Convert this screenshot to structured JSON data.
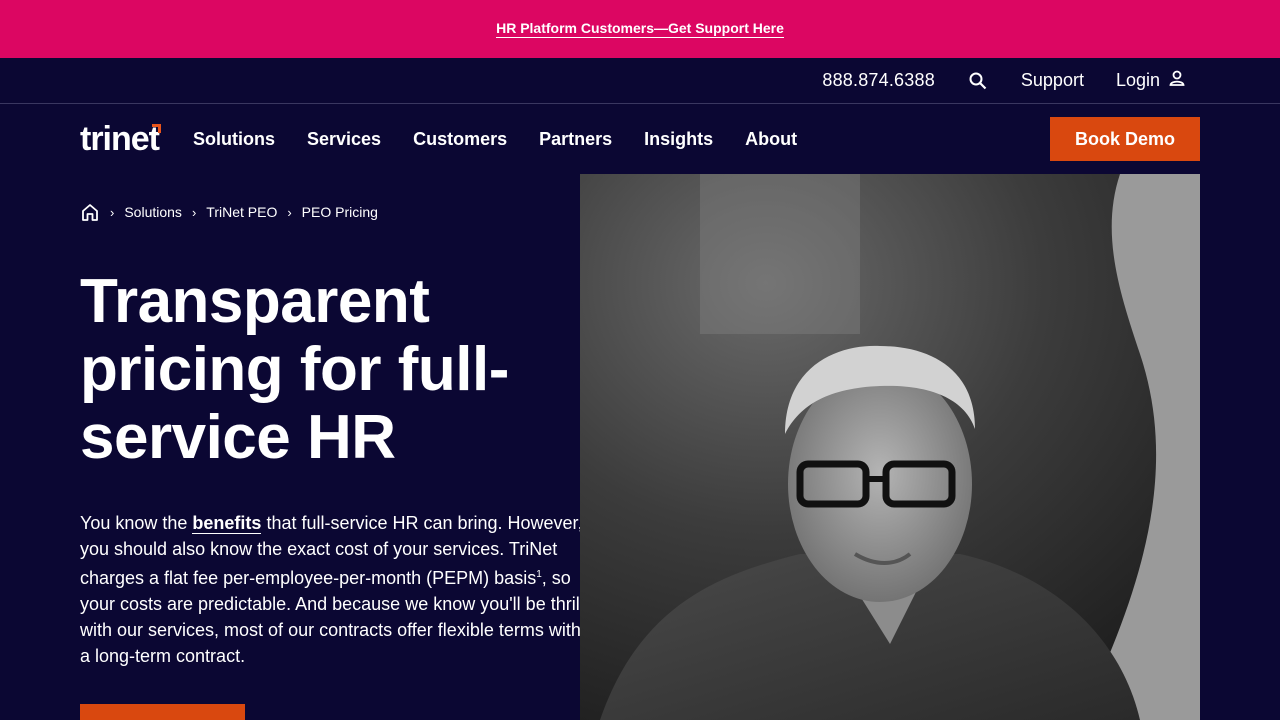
{
  "promo": {
    "link_text": "HR Platform Customers—Get Support Here"
  },
  "utility": {
    "phone": "888.874.6388",
    "support": "Support",
    "login": "Login"
  },
  "nav": {
    "logo": "trinet",
    "items": [
      "Solutions",
      "Services",
      "Customers",
      "Partners",
      "Insights",
      "About"
    ],
    "book_demo": "Book Demo"
  },
  "breadcrumb": {
    "items": [
      "Solutions",
      "TriNet PEO",
      "PEO Pricing"
    ]
  },
  "hero": {
    "title": "Transparent pricing for full-service HR",
    "intro_pre": "You know the ",
    "intro_link": "benefits",
    "intro_mid": " that full-service HR can bring. However, you should also know the exact cost of your services. TriNet charges a flat fee per-employee-per-month (PEPM) basis",
    "intro_sup": "1",
    "intro_post": ", so your costs are predictable. And because we know you'll be thrilled with our services, most of our contracts offer flexible terms without a long-term contract."
  },
  "colors": {
    "promo_bg": "#dc0662",
    "nav_bg": "#0b0733",
    "accent": "#d9480f"
  }
}
